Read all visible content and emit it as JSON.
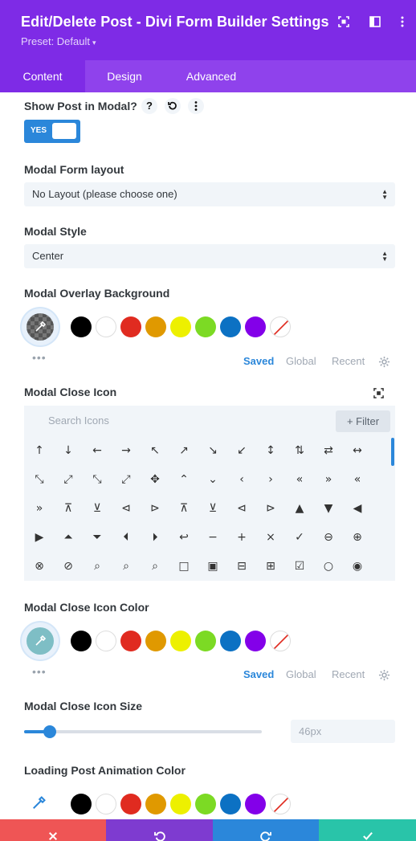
{
  "header": {
    "title": "Edit/Delete Post - Divi Form Builder Settings",
    "preset": "Preset: Default",
    "preset_caret": "▾",
    "icons": [
      "fullscreen-icon",
      "sidebar-toggle-icon",
      "more-options-icon"
    ]
  },
  "tabs": [
    {
      "label": "Content",
      "active": true
    },
    {
      "label": "Design",
      "active": false
    },
    {
      "label": "Advanced",
      "active": false
    }
  ],
  "show_modal": {
    "label": "Show Post in Modal?",
    "help": "?",
    "toggle_label": "YES",
    "toggle_on": true
  },
  "modal_form_layout": {
    "label": "Modal Form layout",
    "value": "No Layout (please choose one)"
  },
  "modal_style": {
    "label": "Modal Style",
    "value": "Center"
  },
  "overlay_background": {
    "label": "Modal Overlay Background",
    "more": "•••",
    "tabs": [
      "Saved",
      "Global",
      "Recent"
    ]
  },
  "swatches": [
    "#000000",
    "#ffffff",
    "#e02b20",
    "#e09900",
    "#edf000",
    "#7cda24",
    "#0c71c3",
    "#8300e9"
  ],
  "close_icon": {
    "label": "Modal Close Icon",
    "search_placeholder": "Search Icons",
    "filter_label": "+ Filter",
    "icons": [
      "↑",
      "↓",
      "←",
      "→",
      "↖",
      "↗",
      "↘",
      "↙",
      "↕",
      "⇅",
      "⇄",
      "↔",
      "⤡",
      "⤢",
      "⤡",
      "⤢",
      "✥",
      "⌃",
      "⌄",
      "‹",
      "›",
      "«",
      "»",
      "«",
      "»",
      "⊼",
      "⊻",
      "⊲",
      "⊳",
      "⊼",
      "⊻",
      "⊲",
      "⊳",
      "▲",
      "▼",
      "◀",
      "▶",
      "⏶",
      "⏷",
      "⏴",
      "⏵",
      "↩",
      "−",
      "+",
      "×",
      "✓",
      "⊖",
      "⊕",
      "⊗",
      "⊘",
      "⌕",
      "⌕",
      "⌕",
      "□",
      "▣",
      "⊟",
      "⊞",
      "☑",
      "○",
      "◉"
    ]
  },
  "close_icon_color": {
    "label": "Modal Close Icon Color",
    "current": "#7ebec5",
    "more": "•••",
    "tabs": [
      "Saved",
      "Global",
      "Recent"
    ]
  },
  "close_icon_size": {
    "label": "Modal Close Icon Size",
    "value": 10,
    "placeholder": "46px"
  },
  "loading_color": {
    "label": "Loading Post Animation Color"
  },
  "colors": {
    "accent": "#2b87da",
    "header": "#7e2be6",
    "footer_cancel": "#ef5555",
    "footer_undo": "#7e3bd0",
    "footer_redo": "#2b87da",
    "footer_save": "#29c4a9"
  },
  "footer": [
    "close-icon",
    "undo-icon",
    "redo-icon",
    "check-icon"
  ]
}
